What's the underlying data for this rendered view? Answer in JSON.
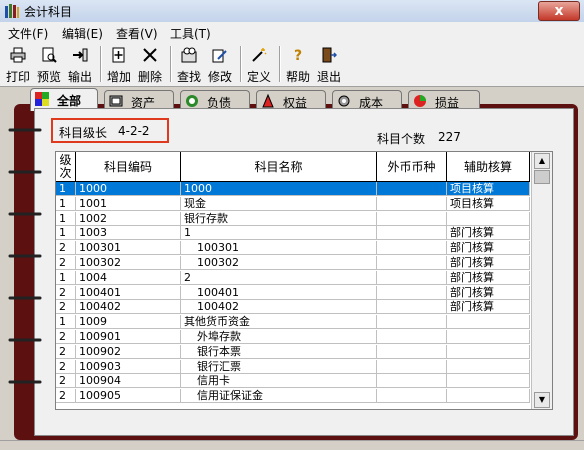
{
  "window": {
    "title": "会计科目",
    "close_label": "x"
  },
  "menu": [
    "文件(F)",
    "编辑(E)",
    "查看(V)",
    "工具(T)"
  ],
  "toolbar": [
    "打印",
    "预览",
    "输出",
    "增加",
    "删除",
    "查找",
    "修改",
    "定义",
    "帮助",
    "退出"
  ],
  "tabs": [
    "全部",
    "资产",
    "负债",
    "权益",
    "成本",
    "损益"
  ],
  "info": {
    "level_label": "科目级长",
    "level_value": "4-2-2",
    "count_label": "科目个数",
    "count_value": "227"
  },
  "table": {
    "headers": [
      "级次",
      "科目编码",
      "科目名称",
      "外币币种",
      "辅助核算"
    ],
    "rows": [
      [
        "1",
        "1000",
        "1000",
        "",
        "项目核算"
      ],
      [
        "1",
        "1001",
        "现金",
        "",
        "项目核算"
      ],
      [
        "1",
        "1002",
        "银行存款",
        "",
        ""
      ],
      [
        "1",
        "1003",
        "1",
        "",
        "部门核算"
      ],
      [
        "2",
        "100301",
        "100301",
        "",
        "部门核算"
      ],
      [
        "2",
        "100302",
        "100302",
        "",
        "部门核算"
      ],
      [
        "1",
        "1004",
        "2",
        "",
        "部门核算"
      ],
      [
        "2",
        "100401",
        "100401",
        "",
        "部门核算"
      ],
      [
        "2",
        "100402",
        "100402",
        "",
        "部门核算"
      ],
      [
        "1",
        "1009",
        "其他货币资金",
        "",
        ""
      ],
      [
        "2",
        "100901",
        "外埠存款",
        "",
        ""
      ],
      [
        "2",
        "100902",
        "银行本票",
        "",
        ""
      ],
      [
        "2",
        "100903",
        "银行汇票",
        "",
        ""
      ],
      [
        "2",
        "100904",
        "信用卡",
        "",
        ""
      ],
      [
        "2",
        "100905",
        "信用证保证金",
        "",
        ""
      ]
    ],
    "selected_row": 0
  },
  "colors": {
    "selection": "#0078d7",
    "binder": "#5c1010",
    "highlight_box": "#e03a1e"
  }
}
